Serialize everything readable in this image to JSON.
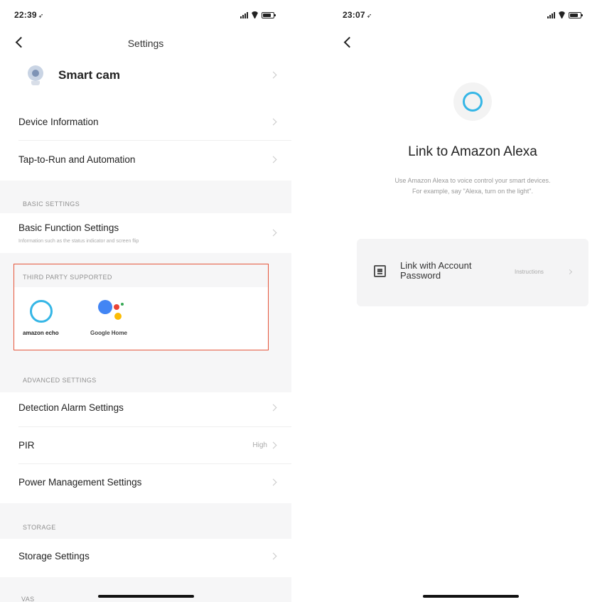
{
  "left_screen": {
    "status_time": "22:39",
    "nav_title": "Settings",
    "device": {
      "name": "Smart cam"
    },
    "rows_top": [
      {
        "label": "Device Information"
      },
      {
        "label": "Tap-to-Run and Automation"
      }
    ],
    "basic_settings": {
      "caption": "BASIC SETTINGS",
      "row_label": "Basic Function Settings",
      "row_sub": "Information such as the status indicator and screen flip"
    },
    "third_party": {
      "caption": "THIRD PARTY SUPPORTED",
      "alexa_label": "amazon echo",
      "google_label": "Google Home",
      "highlight_color": "#e5553a"
    },
    "advanced_settings": {
      "caption": "ADVANCED SETTINGS",
      "rows": [
        {
          "label": "Detection Alarm Settings",
          "value": ""
        },
        {
          "label": "PIR",
          "value": "High"
        },
        {
          "label": "Power Management Settings",
          "value": ""
        }
      ]
    },
    "storage": {
      "caption": "STORAGE",
      "row_label": "Storage Settings"
    },
    "vas_caption": "VAS"
  },
  "right_screen": {
    "status_time": "23:07",
    "title": "Link to Amazon Alexa",
    "desc_line1": "Use Amazon Alexa to voice control your smart devices.",
    "desc_line2": "For example, say \"Alexa, turn on the light\".",
    "link_option": {
      "label_line1": "Link with Account",
      "label_line2": "Password",
      "instructions": "Instructions"
    }
  },
  "colors": {
    "alexa_blue": "#35b6e6",
    "google_blue": "#4285f4",
    "google_red": "#ea4335",
    "google_yellow": "#fbbc05",
    "google_green": "#34a853"
  },
  "icons": {
    "back": "chevron-left-icon",
    "row_arrow": "chevron-right-icon",
    "camera": "smart-camera-icon",
    "alexa": "alexa-ring-icon",
    "google": "google-assistant-icon",
    "account": "account-card-icon"
  }
}
